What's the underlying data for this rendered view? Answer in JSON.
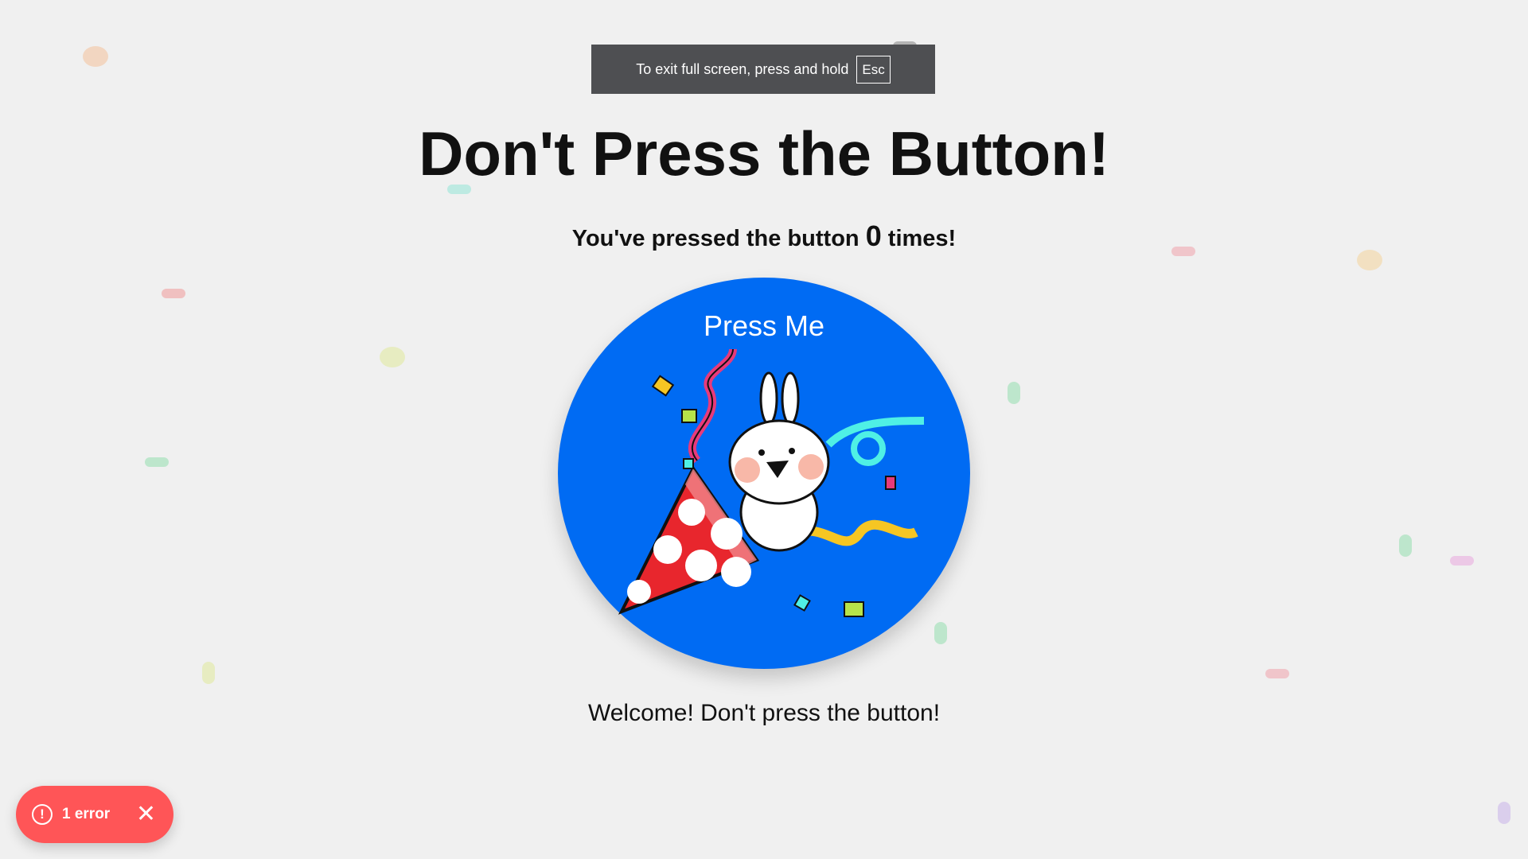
{
  "fullscreen_toast": {
    "text": "To exit full screen, press and hold",
    "key": "Esc"
  },
  "title": "Don't Press the Button!",
  "counter": {
    "prefix": "You've pressed the button",
    "count": "0",
    "suffix": "times!"
  },
  "button": {
    "label": "Press Me",
    "image_icon": "bunny-party-popper-icon"
  },
  "message": "Welcome! Don't press the button!",
  "error_badge": {
    "label": "1 error",
    "icon": "exclamation-circle-icon",
    "close_icon": "close-icon",
    "color": "#ff5557"
  },
  "colors": {
    "background": "#f0f0f0",
    "button": "#006bf3",
    "toast": "#4e4f52"
  }
}
